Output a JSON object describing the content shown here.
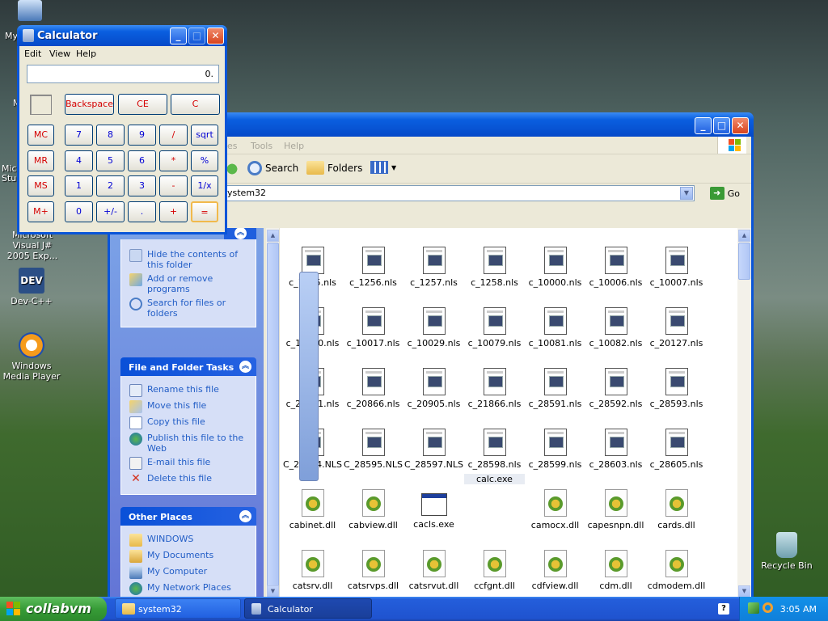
{
  "desktop": {
    "icons": [
      {
        "label": "My",
        "icon": "my-computer-icon"
      },
      {
        "label": "M",
        "icon": "my-network-icon"
      },
      {
        "label": "Microsoft Stu",
        "icon": "visual-studio-icon"
      },
      {
        "label": "Microsoft Visual J# 2005 Exp...",
        "icon": "vj-icon"
      },
      {
        "label": "Dev-C++",
        "icon": "dev-cpp-icon"
      },
      {
        "label": "Windows Media Player",
        "icon": "media-player-icon"
      },
      {
        "label": "Recycle Bin",
        "icon": "recycle-bin-icon"
      }
    ]
  },
  "explorer": {
    "menu": [
      "es",
      "Tools",
      "Help"
    ],
    "toolbar": {
      "search": "Search",
      "folders": "Folders"
    },
    "address": "ystem32",
    "go": "Go",
    "tasks": {
      "top_items": [
        "Hide the contents of this folder",
        "Add or remove programs",
        "Search for files or folders"
      ],
      "file_folder_title": "File and Folder Tasks",
      "file_folder_items": [
        "Rename this file",
        "Move this file",
        "Copy this file",
        "Publish this file to the Web",
        "E-mail this file",
        "Delete this file"
      ],
      "other_places_title": "Other Places",
      "other_places_items": [
        "WINDOWS",
        "My Documents",
        "My Computer",
        "My Network Places"
      ]
    },
    "files": [
      {
        "name": "c_1255.nls",
        "type": "nls"
      },
      {
        "name": "c_1256.nls",
        "type": "nls"
      },
      {
        "name": "c_1257.nls",
        "type": "nls"
      },
      {
        "name": "c_1258.nls",
        "type": "nls"
      },
      {
        "name": "c_10000.nls",
        "type": "nls"
      },
      {
        "name": "c_10006.nls",
        "type": "nls"
      },
      {
        "name": "c_10007.nls",
        "type": "nls"
      },
      {
        "name": "c_10010.nls",
        "type": "nls"
      },
      {
        "name": "c_10017.nls",
        "type": "nls"
      },
      {
        "name": "c_10029.nls",
        "type": "nls"
      },
      {
        "name": "c_10079.nls",
        "type": "nls"
      },
      {
        "name": "c_10081.nls",
        "type": "nls"
      },
      {
        "name": "c_10082.nls",
        "type": "nls"
      },
      {
        "name": "c_20127.nls",
        "type": "nls"
      },
      {
        "name": "c_20261.nls",
        "type": "nls"
      },
      {
        "name": "c_20866.nls",
        "type": "nls"
      },
      {
        "name": "c_20905.nls",
        "type": "nls"
      },
      {
        "name": "c_21866.nls",
        "type": "nls"
      },
      {
        "name": "c_28591.nls",
        "type": "nls"
      },
      {
        "name": "c_28592.nls",
        "type": "nls"
      },
      {
        "name": "c_28593.nls",
        "type": "nls"
      },
      {
        "name": "C_28594.NLS",
        "type": "nls"
      },
      {
        "name": "C_28595.NLS",
        "type": "nls"
      },
      {
        "name": "C_28597.NLS",
        "type": "nls"
      },
      {
        "name": "c_28598.nls",
        "type": "nls"
      },
      {
        "name": "c_28599.nls",
        "type": "nls"
      },
      {
        "name": "c_28603.nls",
        "type": "nls"
      },
      {
        "name": "c_28605.nls",
        "type": "nls"
      },
      {
        "name": "cabinet.dll",
        "type": "dll"
      },
      {
        "name": "cabview.dll",
        "type": "dll"
      },
      {
        "name": "cacls.exe",
        "type": "exe"
      },
      {
        "name": "calc.exe",
        "type": "calc"
      },
      {
        "name": "camocx.dll",
        "type": "dll"
      },
      {
        "name": "capesnpn.dll",
        "type": "dll"
      },
      {
        "name": "cards.dll",
        "type": "dll"
      },
      {
        "name": "catsrv.dll",
        "type": "dll"
      },
      {
        "name": "catsrvps.dll",
        "type": "dll"
      },
      {
        "name": "catsrvut.dll",
        "type": "dll"
      },
      {
        "name": "ccfgnt.dll",
        "type": "dll"
      },
      {
        "name": "cdfview.dll",
        "type": "dll"
      },
      {
        "name": "cdm.dll",
        "type": "dll"
      },
      {
        "name": "cdmodem.dll",
        "type": "dll"
      }
    ]
  },
  "calculator": {
    "title": "Calculator",
    "menu": [
      "Edit",
      "View",
      "Help"
    ],
    "display": "0.",
    "top_buttons": [
      "Backspace",
      "CE",
      "C"
    ],
    "memory_buttons": [
      "MC",
      "MR",
      "MS",
      "M+"
    ],
    "rows": [
      [
        "7",
        "8",
        "9",
        "/",
        "sqrt"
      ],
      [
        "4",
        "5",
        "6",
        "*",
        "%"
      ],
      [
        "1",
        "2",
        "3",
        "-",
        "1/x"
      ],
      [
        "0",
        "+/-",
        ".",
        "+",
        "="
      ]
    ]
  },
  "taskbar": {
    "start": "collabvm",
    "buttons": [
      "system32",
      "Calculator"
    ],
    "clock": "3:05 AM"
  }
}
